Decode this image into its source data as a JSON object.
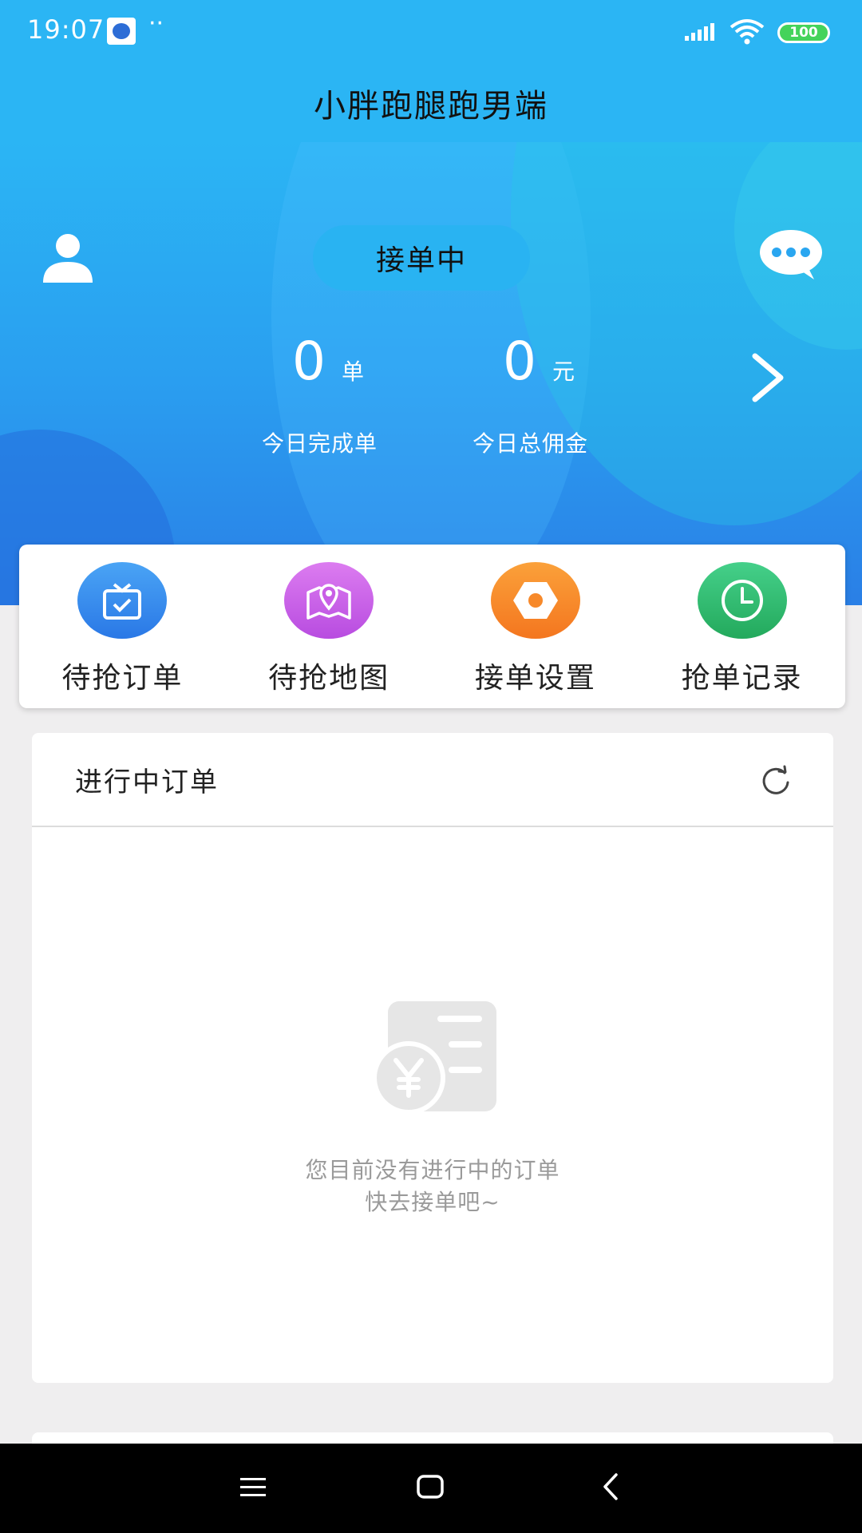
{
  "status_bar": {
    "time": "19:07",
    "dots": "··",
    "battery": "100",
    "icons": [
      "app-notification-icon",
      "signal-icon",
      "wifi-icon",
      "battery-icon"
    ]
  },
  "app": {
    "title": "小胖跑腿跑男端"
  },
  "hero": {
    "status_button": "接单中",
    "stats": [
      {
        "value": "0",
        "unit": "单",
        "label": "今日完成单"
      },
      {
        "value": "0",
        "unit": "元",
        "label": "今日总佣金"
      }
    ],
    "icons": [
      "user-avatar-icon",
      "message-icon",
      "chevron-right-icon"
    ]
  },
  "quick_menu": {
    "items": [
      {
        "label": "待抢订单",
        "icon": "order-box-icon",
        "color": "#3a8ef0"
      },
      {
        "label": "待抢地图",
        "icon": "map-pin-icon",
        "color": "#c65ce6"
      },
      {
        "label": "接单设置",
        "icon": "hex-nut-icon",
        "color": "#f7892a"
      },
      {
        "label": "抢单记录",
        "icon": "clock-icon",
        "color": "#32bb6e"
      }
    ]
  },
  "orders": {
    "title": "进行中订单",
    "empty_line1": "您目前没有进行中的订单",
    "empty_line2": "快去接单吧~",
    "icons": [
      "refresh-icon",
      "empty-order-illustration"
    ]
  },
  "nav_bar": {
    "icons": [
      "menu-icon",
      "home-icon",
      "back-icon"
    ]
  },
  "colors": {
    "primary": "#2bb5f4",
    "hero_bottom": "#2a7fe6",
    "background": "#efeeef"
  }
}
